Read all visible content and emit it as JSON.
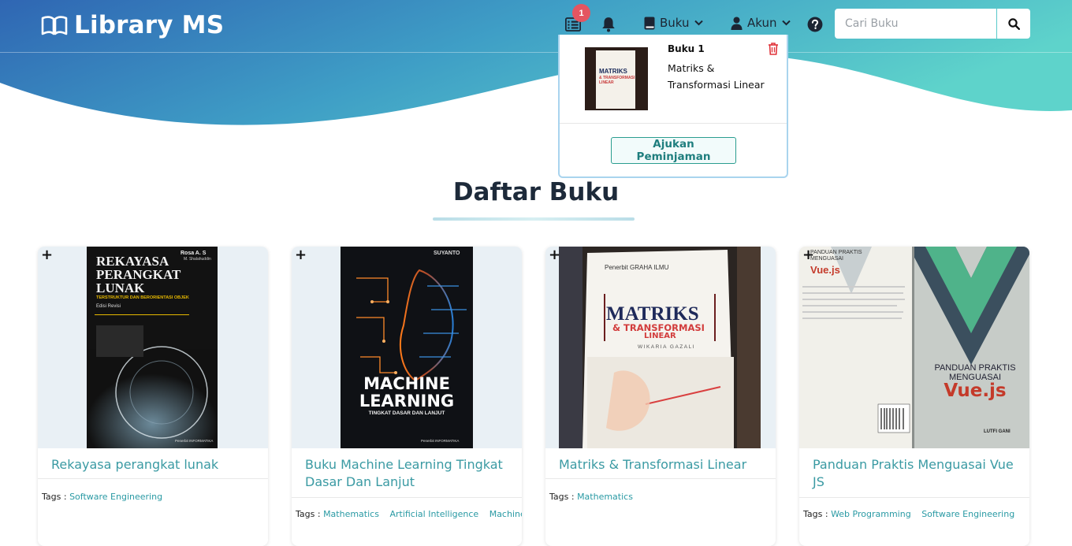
{
  "brand": {
    "title": "Library MS"
  },
  "nav": {
    "cart_badge": "1",
    "books_menu": "Buku",
    "account_menu": "Akun",
    "search_placeholder": "Cari Buku"
  },
  "cart": {
    "item_title": "Buku 1",
    "item_name": "Matriks & Transformasi Linear",
    "submit_label": "Ajukan Peminjaman",
    "thumb_title": "MATRIKS",
    "thumb_subtitle": "& TRANSFORMASI LINEAR"
  },
  "page": {
    "title": "Daftar Buku"
  },
  "tags_label": "Tags :",
  "books": [
    {
      "title": "Rekayasa perangkat lunak",
      "tags": [
        "Software Engineering"
      ],
      "cover": {
        "author": "Rosa A. S",
        "author2": "M. Shalahuddin",
        "line1": "REKAYASA",
        "line2": "PERANGKAT",
        "line3": "LUNAK",
        "subtitle": "TERSTRUKTUR DAN BERORIENTASI OBJEK",
        "edition": "Edisi Revisi",
        "publisher": "Penerbit INFORMATIKA"
      }
    },
    {
      "title": "Buku Machine Learning Tingkat Dasar Dan Lanjut",
      "tags": [
        "Mathematics",
        "Artificial Intelligence",
        "Machine"
      ],
      "cover": {
        "author": "SUYANTO",
        "line1": "MACHINE",
        "line2": "LEARNING",
        "subtitle": "TINGKAT DASAR DAN LANJUT",
        "publisher": "Penerbit INFORMATIKA"
      }
    },
    {
      "title": "Matriks & Transformasi Linear",
      "tags": [
        "Mathematics"
      ],
      "cover": {
        "publisher": "Penerbit GRAHA ILMU",
        "line1": "MATRIKS",
        "line2": "& TRANSFORMASI",
        "line3": "LINEAR",
        "author": "WIKARIA GAZALI"
      }
    },
    {
      "title": "Panduan Praktis Menguasai Vue JS",
      "tags": [
        "Web Programming",
        "Software Engineering"
      ],
      "cover": {
        "back_title": "PANDUAN PRAKTIS MENGUASAI",
        "back_vue": "Vue.js",
        "front_title": "PANDUAN PRAKTIS MENGUASAI",
        "front_vue": "Vue.js",
        "author": "LUTFI GANI"
      }
    }
  ],
  "colors": {
    "accent": "#3a9aa3",
    "header_start": "#2e6fb5",
    "header_end": "#5cd0cd",
    "badge": "#e45561"
  }
}
